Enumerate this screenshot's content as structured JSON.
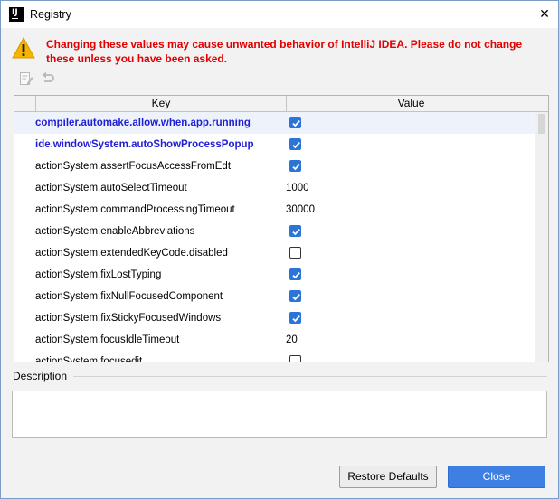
{
  "window": {
    "title": "Registry",
    "app_icon_text": "IJ",
    "close_glyph": "✕"
  },
  "warning": {
    "icon": "warning-triangle-icon",
    "text": "Changing these values may cause unwanted behavior of IntelliJ IDEA. Please do not change these unless you have been asked."
  },
  "toolbar": {
    "items": [
      {
        "name": "edit-icon"
      },
      {
        "name": "revert-icon"
      }
    ]
  },
  "table": {
    "headers": {
      "key": "Key",
      "value": "Value"
    },
    "rows": [
      {
        "key": "compiler.automake.allow.when.app.running",
        "type": "bool",
        "checked": true,
        "changed": true,
        "selected": true
      },
      {
        "key": "ide.windowSystem.autoShowProcessPopup",
        "type": "bool",
        "checked": true,
        "changed": true
      },
      {
        "key": "actionSystem.assertFocusAccessFromEdt",
        "type": "bool",
        "checked": true
      },
      {
        "key": "actionSystem.autoSelectTimeout",
        "type": "text",
        "value": "1000"
      },
      {
        "key": "actionSystem.commandProcessingTimeout",
        "type": "text",
        "value": "30000"
      },
      {
        "key": "actionSystem.enableAbbreviations",
        "type": "bool",
        "checked": true
      },
      {
        "key": "actionSystem.extendedKeyCode.disabled",
        "type": "bool",
        "checked": false
      },
      {
        "key": "actionSystem.fixLostTyping",
        "type": "bool",
        "checked": true
      },
      {
        "key": "actionSystem.fixNullFocusedComponent",
        "type": "bool",
        "checked": true
      },
      {
        "key": "actionSystem.fixStickyFocusedWindows",
        "type": "bool",
        "checked": true
      },
      {
        "key": "actionSystem.focusIdleTimeout",
        "type": "text",
        "value": "20"
      },
      {
        "key": "actionSystem.focusedit",
        "type": "bool",
        "checked": false
      }
    ]
  },
  "description": {
    "label": "Description",
    "text": ""
  },
  "buttons": {
    "restore": "Restore Defaults",
    "close": "Close"
  },
  "colors": {
    "warning_text": "#e30000",
    "changed_key": "#1f1ed6",
    "checkbox_on": "#2c75d8",
    "primary_button": "#3d7fe2"
  }
}
